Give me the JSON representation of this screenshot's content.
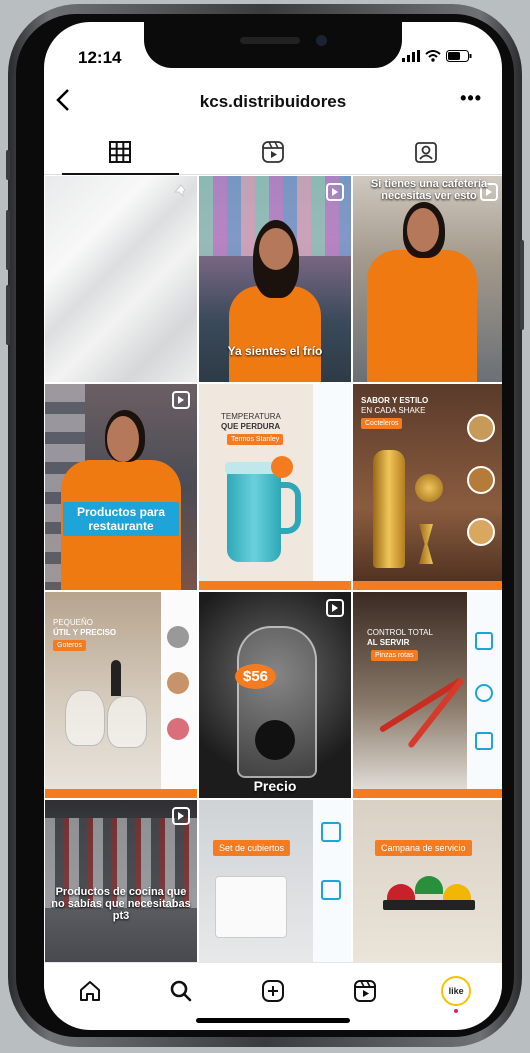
{
  "status_bar": {
    "time": "12:14"
  },
  "header": {
    "title": "kcs.distribuidores",
    "back_icon": "back-arrow-icon",
    "more_label": "•••"
  },
  "tabs": [
    {
      "name": "grid",
      "icon": "grid-icon",
      "active": true
    },
    {
      "name": "reels",
      "icon": "reels-icon",
      "active": false
    },
    {
      "name": "tagged",
      "icon": "tagged-icon",
      "active": false
    }
  ],
  "posts": {
    "p2": {
      "caption": "Ya sientes el frío"
    },
    "p3": {
      "caption": "Si tienes una cafetería necesitas ver esto"
    },
    "p4": {
      "caption": "Productos para restaurante"
    },
    "p5": {
      "title_line1": "TEMPERATURA",
      "title_line2": "QUE PERDURA",
      "badge": "Termos Stanley"
    },
    "p6": {
      "title_line1": "SABOR Y ESTILO",
      "title_line2": "EN CADA SHAKE",
      "badge": "Cocteleros"
    },
    "p7": {
      "title_line1": "PEQUEÑO",
      "title_line2": "ÚTIL Y PRECISO",
      "badge": "Goteros"
    },
    "p8": {
      "price": "$56",
      "caption": "Precio"
    },
    "p9": {
      "title_line1": "CONTROL TOTAL",
      "title_line2": "AL SERVIR",
      "badge": "Pinzas rotas"
    },
    "p10": {
      "caption": "Productos de cocina que no sabías que necesitabas pt3"
    },
    "p11": {
      "badge": "Set de cubiertos"
    },
    "p12": {
      "badge": "Campana de servicio"
    }
  },
  "bottom_nav": {
    "like_label": "like"
  },
  "colors": {
    "accent": "#f47b20",
    "blue": "#1ea4d8",
    "shirt": "#f07a12"
  }
}
